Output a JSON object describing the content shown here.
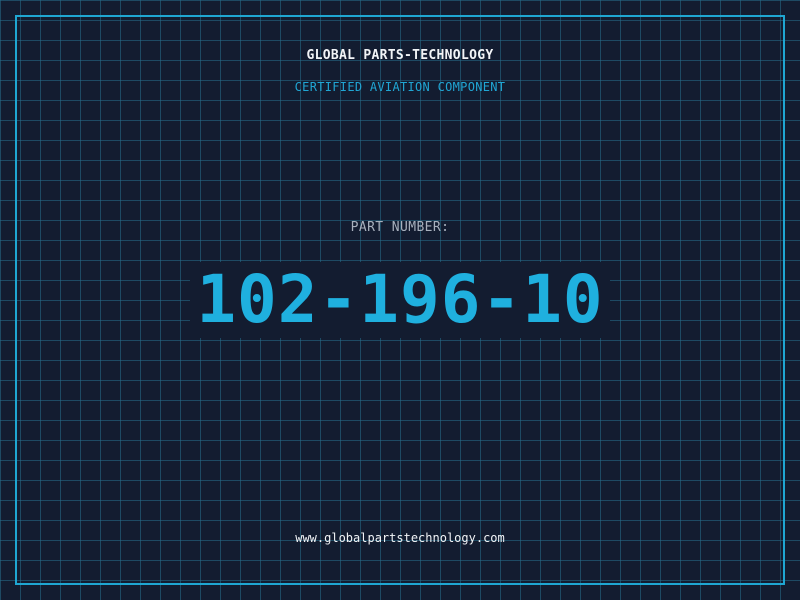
{
  "header": {
    "title": "GLOBAL PARTS-TECHNOLOGY",
    "subtitle": "CERTIFIED AVIATION COMPONENT"
  },
  "part": {
    "label": "PART NUMBER:",
    "number": "102-196-10"
  },
  "footer": {
    "url": "www.globalpartstechnology.com"
  },
  "colors": {
    "background": "#131c30",
    "grid": "#266e8c",
    "accent": "#1fa6d2",
    "text": "#f2f4f7",
    "muted": "#a8b0bd"
  }
}
